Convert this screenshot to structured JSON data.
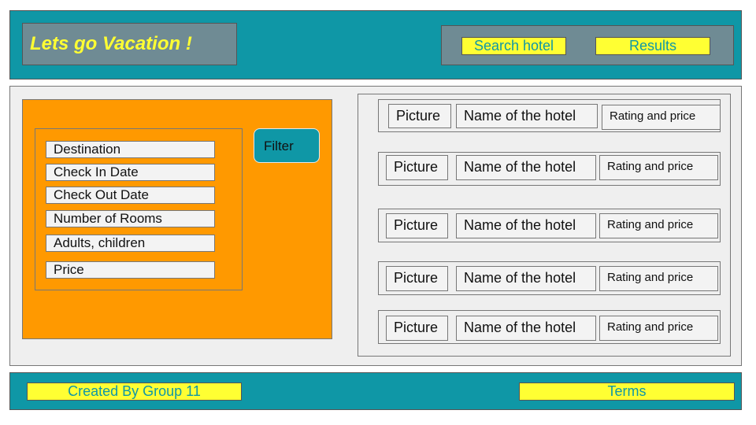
{
  "header": {
    "brand": "Lets go Vacation !",
    "nav": {
      "search_hotel": "Search hotel",
      "results": "Results"
    }
  },
  "filters": {
    "fields": [
      "Destination",
      "Check In Date",
      "Check Out Date",
      "Number of Rooms",
      "Adults, children",
      "Price"
    ],
    "button": "Filter"
  },
  "results": [
    {
      "picture": "Picture",
      "name": "Name of the hotel",
      "rating_price": "Rating and price"
    },
    {
      "picture": "Picture",
      "name": "Name of the hotel",
      "rating_price": "Rating and price"
    },
    {
      "picture": "Picture",
      "name": "Name of the hotel",
      "rating_price": "Rating and price"
    },
    {
      "picture": "Picture",
      "name": "Name of the hotel",
      "rating_price": "Rating and price"
    },
    {
      "picture": "Picture",
      "name": "Name of the hotel",
      "rating_price": "Rating and price"
    }
  ],
  "footer": {
    "credit": "Created By Group 11",
    "terms": "Terms"
  },
  "colors": {
    "teal": "#0f97a6",
    "orange": "#ff9900",
    "yellow": "#ffff33",
    "slate": "#6f8b94"
  }
}
